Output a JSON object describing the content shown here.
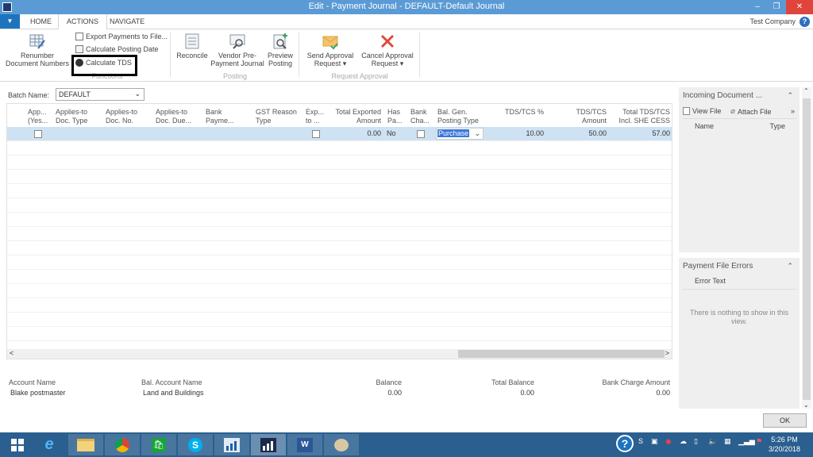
{
  "window": {
    "title": "Edit - Payment Journal - DEFAULT-Default Journal",
    "minimize": "–",
    "maximize": "❐",
    "close": "✕"
  },
  "tabs": [
    {
      "label": "HOME"
    },
    {
      "label": "ACTIONS",
      "active": true
    },
    {
      "label": "NAVIGATE"
    }
  ],
  "company": "Test Company",
  "help_glyph": "?",
  "ribbon": {
    "renumber": "Renumber Document Numbers",
    "renumber_l1": "Renumber",
    "renumber_l2": "Document Numbers",
    "export_payments": "Export Payments to File...",
    "calc_posting_date": "Calculate Posting Date",
    "calc_tds": "Calculate TDS",
    "functions_group": "Functions",
    "reconcile": "Reconcile",
    "vendor_pre_l1": "Vendor Pre-",
    "vendor_pre_l2": "Payment Journal",
    "preview_l1": "Preview",
    "preview_l2": "Posting",
    "posting_group": "Posting",
    "send_l1": "Send Approval",
    "send_l2": "Request ▾",
    "cancel_l1": "Cancel Approval",
    "cancel_l2": "Request ▾",
    "approval_group": "Request Approval"
  },
  "batch": {
    "label": "Batch Name:",
    "value": "DEFAULT"
  },
  "grid": {
    "columns": [
      {
        "l1": "App...",
        "l2": "(Yes..."
      },
      {
        "l1": "Applies-to",
        "l2": "Doc. Type"
      },
      {
        "l1": "Applies-to",
        "l2": "Doc. No."
      },
      {
        "l1": "Applies-to",
        "l2": "Doc. Due..."
      },
      {
        "l1": "Bank",
        "l2": "Payme..."
      },
      {
        "l1": "GST Reason",
        "l2": "Type"
      },
      {
        "l1": "Exp...",
        "l2": "to ..."
      },
      {
        "l1": "Total Exported",
        "l2": "Amount"
      },
      {
        "l1": "Has",
        "l2": "Pa..."
      },
      {
        "l1": "Bank",
        "l2": "Cha..."
      },
      {
        "l1": "Bal. Gen.",
        "l2": "Posting Type"
      },
      {
        "l1": "TDS/TCS %",
        "l2": ""
      },
      {
        "l1": "TDS/TCS",
        "l2": "Amount"
      },
      {
        "l1": "Total TDS/TCS",
        "l2": "Incl. SHE CESS"
      }
    ],
    "rows": [
      {
        "applies_yes": false,
        "exported": false,
        "total_exported_amount": "0.00",
        "has_payment": "No",
        "bank_charge": false,
        "bal_gen_posting_type": "Purchase",
        "tds_tcs_pct": "10.00",
        "tds_tcs_amount": "50.00",
        "total_tds_tcs_incl_she_cess": "57.00"
      }
    ],
    "scroll_left": "<",
    "scroll_right": ">"
  },
  "footer": {
    "account_name_label": "Account Name",
    "account_name": "Blake postmaster",
    "bal_account_name_label": "Bal. Account Name",
    "bal_account_name": "Land and Buildings",
    "balance_label": "Balance",
    "balance": "0.00",
    "total_balance_label": "Total Balance",
    "total_balance": "0.00",
    "bank_charge_label": "Bank Charge Amount",
    "bank_charge": "0.00"
  },
  "factbox_incoming": {
    "title": "Incoming Document ...",
    "view_file": "View File",
    "attach_file": "Attach File",
    "more": "»",
    "col_name": "Name",
    "col_type": "Type"
  },
  "factbox_errors": {
    "title": "Payment File Errors",
    "col_error": "Error Text",
    "empty": "There is nothing to show in this view."
  },
  "ok_button": "OK",
  "taskbar": {
    "apps": [
      "start",
      "internet-explorer",
      "file-explorer",
      "chrome",
      "store",
      "skype",
      "dynamics-nav",
      "dynamics-nav-active",
      "word",
      "paint"
    ],
    "time": "5:26 PM",
    "date": "3/20/2018"
  }
}
